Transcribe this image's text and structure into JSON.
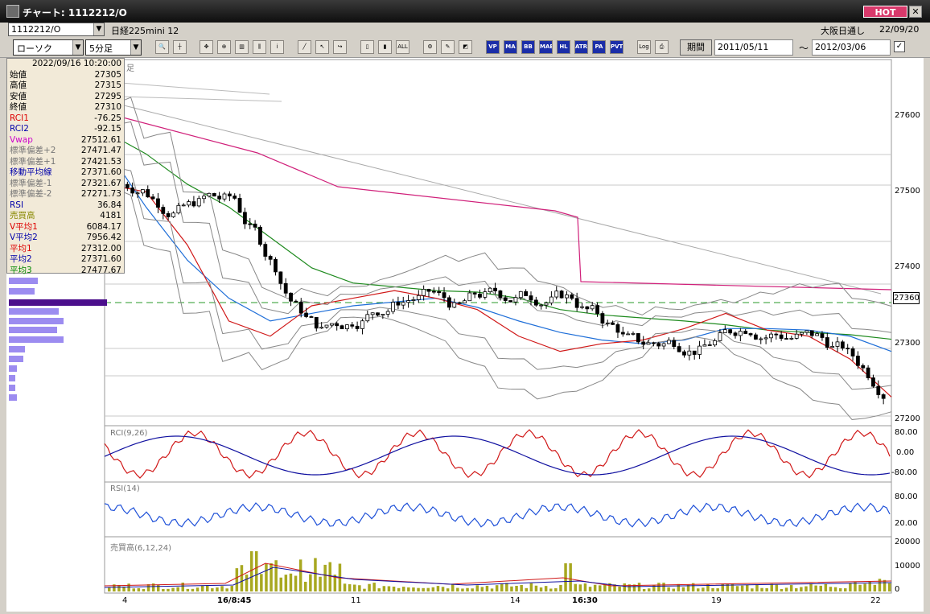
{
  "window": {
    "title": "チャート: 1112212/O",
    "hot_label": "HOT",
    "close_label": "✕"
  },
  "symbol": {
    "code": "1112212/O",
    "name": "日経225mini 12",
    "session": "大阪日通し",
    "date": "22/09/20"
  },
  "toolbar": {
    "chart_type": "ローソク",
    "interval": "5分足",
    "period_label": "期間",
    "from_date": "2011/05/11",
    "to_date": "2012/03/06",
    "tilde": "〜",
    "icons": [
      "zoom-icon",
      "crosshair-icon",
      "cursor-icon",
      "compare-icon",
      "chart-icon",
      "candles-icon",
      "info-icon",
      "draw-line-icon",
      "select-icon",
      "arrow-icon",
      "candle-a-icon",
      "candle-b-icon",
      "all-icon",
      "settings-icon",
      "pen-icon",
      "color-icon"
    ],
    "indicator_buttons": [
      "VP",
      "MA",
      "BB",
      "MAE",
      "HL",
      "ATR",
      "PA",
      "PVT"
    ],
    "extra_buttons": [
      "Log",
      "print-icon"
    ]
  },
  "info": {
    "datetime": "2022/09/16  10:20:00",
    "rows": [
      {
        "label": "始値",
        "value": "27305",
        "color": "#000"
      },
      {
        "label": "高値",
        "value": "27315",
        "color": "#000"
      },
      {
        "label": "安値",
        "value": "27295",
        "color": "#000"
      },
      {
        "label": "終値",
        "value": "27310",
        "color": "#000"
      },
      {
        "label": "RCI1",
        "value": "-76.25",
        "color": "#d00"
      },
      {
        "label": "RCI2",
        "value": "-92.15",
        "color": "#00a"
      },
      {
        "label": "Vwap",
        "value": "27512.61",
        "color": "#c0c"
      },
      {
        "label": "標準偏差+2",
        "value": "27471.47",
        "color": "#777"
      },
      {
        "label": "標準偏差+1",
        "value": "27421.53",
        "color": "#777"
      },
      {
        "label": "移動平均線",
        "value": "27371.60",
        "color": "#00a"
      },
      {
        "label": "標準偏差-1",
        "value": "27321.67",
        "color": "#777"
      },
      {
        "label": "標準偏差-2",
        "value": "27271.73",
        "color": "#777"
      },
      {
        "label": "RSI",
        "value": "36.84",
        "color": "#00a"
      },
      {
        "label": "売買高",
        "value": "4181",
        "color": "#880"
      },
      {
        "label": "V平均1",
        "value": "6084.17",
        "color": "#d00"
      },
      {
        "label": "V平均2",
        "value": "7956.42",
        "color": "#00a"
      },
      {
        "label": "平均1",
        "value": "27312.00",
        "color": "#d00"
      },
      {
        "label": "平均2",
        "value": "27371.60",
        "color": "#00a"
      },
      {
        "label": "平均3",
        "value": "27477.67",
        "color": "#080"
      }
    ]
  },
  "price_axis": {
    "labels": [
      "27600",
      "27500",
      "27400",
      "27300",
      "27200"
    ],
    "current": "27360"
  },
  "rci_panel": {
    "label": "RCI(9,26)",
    "axis": [
      "80.00",
      "0.00",
      "-80.00"
    ]
  },
  "rsi_panel": {
    "label": "RSI(14)",
    "axis": [
      "80.00",
      "20.00"
    ]
  },
  "vol_panel": {
    "label": "売買高(6,12,24)",
    "axis": [
      "20000",
      "10000",
      "0"
    ]
  },
  "x_axis": [
    "4",
    "16/8:45",
    "11",
    "14",
    "16:30",
    "19",
    "22"
  ],
  "main_label": "足",
  "chart_data": {
    "type": "line",
    "title": "",
    "ylim": [
      27180,
      27680
    ],
    "series": [
      {
        "name": "Vwap",
        "values": [
          27612,
          27595,
          27560,
          27520,
          27480,
          27478,
          27476,
          27474,
          27474,
          27366,
          27364,
          27362,
          27360,
          27358,
          27357,
          27355,
          27353,
          27352,
          27351,
          27350
        ]
      },
      {
        "name": "平均3",
        "values": [
          27580,
          27550,
          27510,
          27480,
          27440,
          27400,
          27380,
          27375,
          27370,
          27368,
          27360,
          27345,
          27338,
          27334,
          27330,
          27325,
          27318,
          27315,
          27312,
          27306
        ]
      },
      {
        "name": "平均2",
        "values": [
          27560,
          27480,
          27410,
          27360,
          27330,
          27340,
          27350,
          27355,
          27360,
          27348,
          27330,
          27315,
          27305,
          27300,
          27305,
          27320,
          27320,
          27318,
          27310,
          27290
        ]
      },
      {
        "name": "平均1",
        "values": [
          27510,
          27500,
          27430,
          27330,
          27310,
          27350,
          27360,
          27370,
          27360,
          27345,
          27310,
          27290,
          27300,
          27305,
          27320,
          27340,
          27318,
          27310,
          27280,
          27230
        ]
      }
    ]
  }
}
